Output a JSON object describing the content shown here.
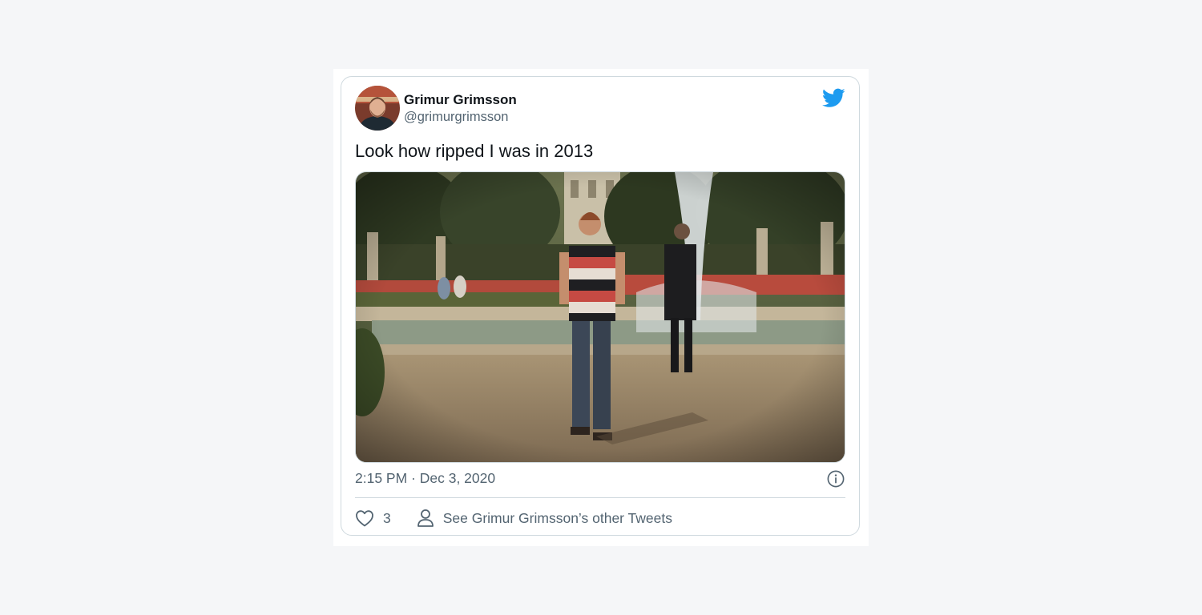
{
  "tweet": {
    "author_name": "Grimur Grimsson",
    "author_handle": "@grimurgrimsson",
    "text": "Look how ripped I was in 2013",
    "timestamp": "2:15 PM · Dec 3, 2020",
    "like_count": "3",
    "other_tweets_label": "See Grimur Grimsson’s other Tweets"
  },
  "icons": {
    "brand": "twitter-bird-icon",
    "info": "info-icon",
    "like": "heart-icon",
    "profile": "person-icon"
  },
  "colors": {
    "brand": "#1d9bf0",
    "text_primary": "#0f1419",
    "text_secondary": "#536471",
    "border": "#cfd9de"
  }
}
